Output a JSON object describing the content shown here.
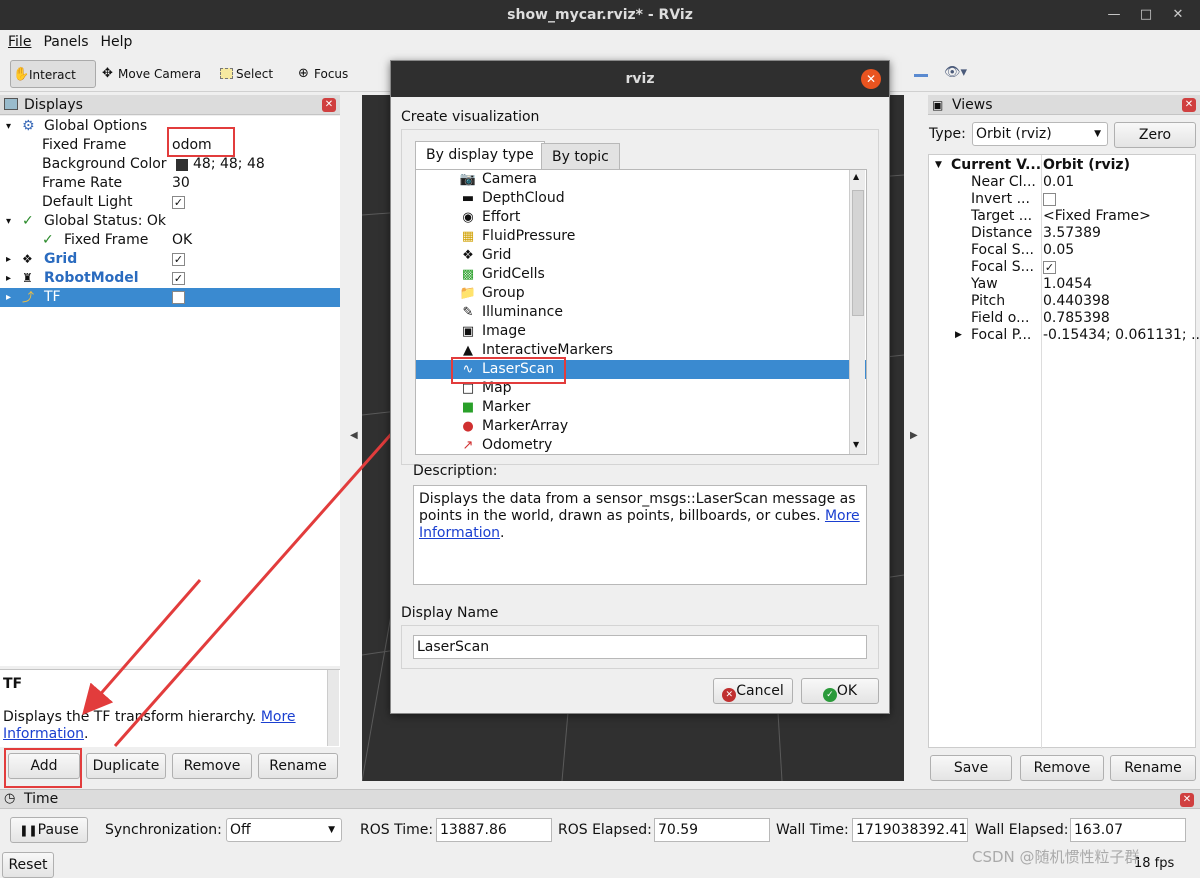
{
  "window": {
    "title": "show_mycar.rviz* - RViz"
  },
  "menu": [
    "File",
    "Panels",
    "Help"
  ],
  "toolbar": {
    "interact": "Interact",
    "move_camera": "Move Camera",
    "select": "Select",
    "focus_camera": "Focus Camera"
  },
  "displays": {
    "title": "Displays",
    "global_options": "Global Options",
    "fixed_frame_label": "Fixed Frame",
    "fixed_frame_value": "odom",
    "bg_label": "Background Color",
    "bg_value": "48; 48; 48",
    "frame_rate_label": "Frame Rate",
    "frame_rate_value": "30",
    "default_light_label": "Default Light",
    "global_status": "Global Status: Ok",
    "status_fixed_frame": "Fixed Frame",
    "status_fixed_frame_value": "OK",
    "grid": "Grid",
    "robot_model": "RobotModel",
    "tf": "TF",
    "desc_title": "TF",
    "desc_text": "Displays the TF transform hierarchy.",
    "desc_link1": "More",
    "desc_link2": "Information",
    "buttons": {
      "add": "Add",
      "duplicate": "Duplicate",
      "remove": "Remove",
      "rename": "Rename"
    }
  },
  "dialog": {
    "title": "rviz",
    "create_label": "Create visualization",
    "tabs": [
      "By display type",
      "By topic"
    ],
    "items": [
      {
        "label": "Camera",
        "icon": "camera-icon"
      },
      {
        "label": "DepthCloud",
        "icon": "depthcloud-icon"
      },
      {
        "label": "Effort",
        "icon": "effort-icon"
      },
      {
        "label": "FluidPressure",
        "icon": "fluidpressure-icon"
      },
      {
        "label": "Grid",
        "icon": "grid-icon"
      },
      {
        "label": "GridCells",
        "icon": "gridcells-icon"
      },
      {
        "label": "Group",
        "icon": "folder-icon"
      },
      {
        "label": "Illuminance",
        "icon": "illuminance-icon"
      },
      {
        "label": "Image",
        "icon": "image-icon"
      },
      {
        "label": "InteractiveMarkers",
        "icon": "interactive-markers-icon"
      },
      {
        "label": "LaserScan",
        "icon": "laserscan-icon"
      },
      {
        "label": "Map",
        "icon": "map-icon"
      },
      {
        "label": "Marker",
        "icon": "marker-icon"
      },
      {
        "label": "MarkerArray",
        "icon": "marker-array-icon"
      },
      {
        "label": "Odometry",
        "icon": "odometry-icon"
      }
    ],
    "selected": "LaserScan",
    "description_label": "Description:",
    "description_text": "Displays the data from a sensor_msgs::LaserScan message as points in the world, drawn as points, billboards, or cubes.",
    "description_link1": "More",
    "description_link2": "Information",
    "display_name_label": "Display Name",
    "display_name_value": "LaserScan",
    "cancel": "Cancel",
    "ok": "OK"
  },
  "views": {
    "title": "Views",
    "type_label": "Type:",
    "type_value": "Orbit (rviz)",
    "zero": "Zero",
    "props": [
      {
        "k": "Current V...",
        "v": "Orbit (rviz)"
      },
      {
        "k": "Near Cl...",
        "v": "0.01"
      },
      {
        "k": "Invert ...",
        "v": ""
      },
      {
        "k": "Target ...",
        "v": "<Fixed Frame>"
      },
      {
        "k": "Distance",
        "v": "3.57389"
      },
      {
        "k": "Focal S...",
        "v": "0.05"
      },
      {
        "k": "Focal S...",
        "v": ""
      },
      {
        "k": "Yaw",
        "v": "1.0454"
      },
      {
        "k": "Pitch",
        "v": "0.440398"
      },
      {
        "k": "Field o...",
        "v": "0.785398"
      },
      {
        "k": "Focal P...",
        "v": "-0.15434; 0.061131; ..."
      }
    ],
    "save": "Save",
    "remove": "Remove",
    "rename": "Rename"
  },
  "time": {
    "title": "Time",
    "pause": "Pause",
    "sync_label": "Synchronization:",
    "sync_value": "Off",
    "ros_time_label": "ROS Time:",
    "ros_time": "13887.86",
    "ros_elapsed_label": "ROS Elapsed:",
    "ros_elapsed": "70.59",
    "wall_time_label": "Wall Time:",
    "wall_time": "1719038392.41",
    "wall_elapsed_label": "Wall Elapsed:",
    "wall_elapsed": "163.07",
    "reset": "Reset",
    "fps": "18 fps"
  },
  "watermark": "CSDN @随机惯性粒子群",
  "colors": {
    "selection": "#3a8ad0",
    "annotation": "#e23c3c",
    "viewport": "#303030",
    "titlebar": "#2f2f2f"
  }
}
